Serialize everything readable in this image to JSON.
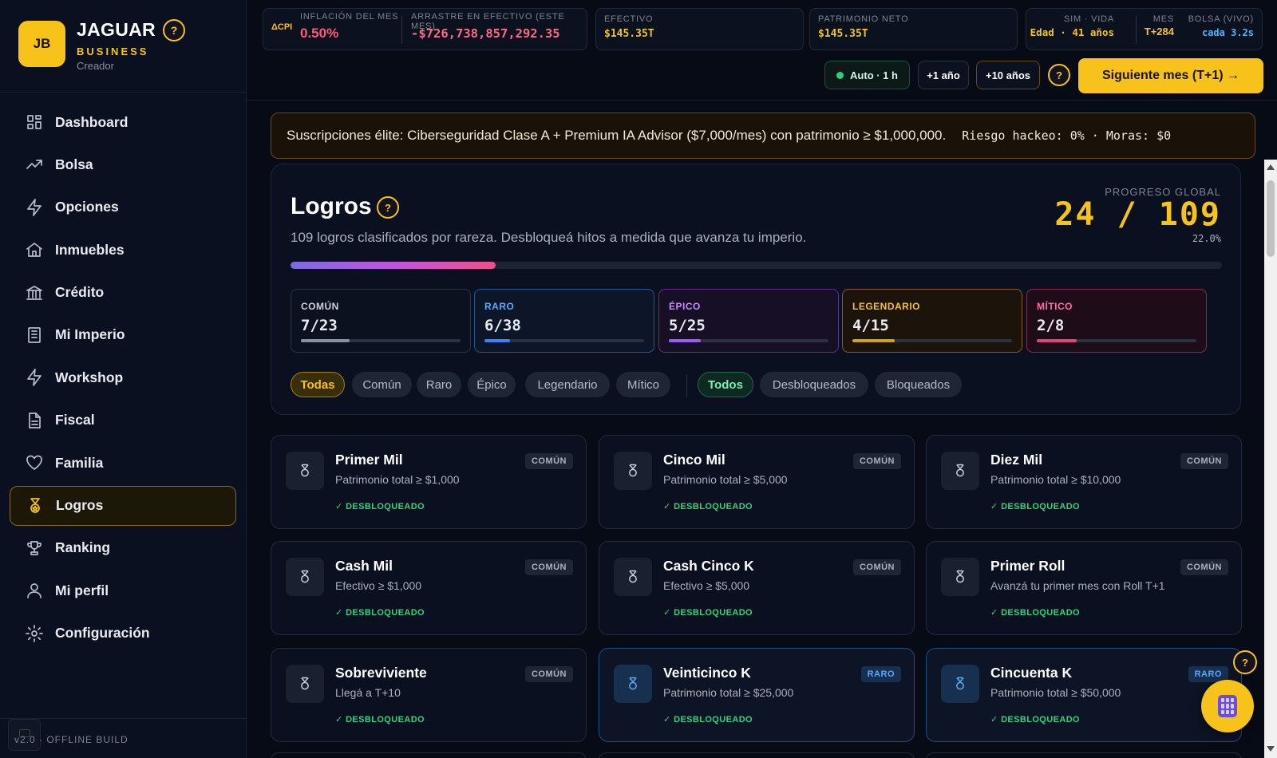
{
  "brand": {
    "logo": "JB",
    "name": "JAGUAR",
    "subtitle": "BUSINESS",
    "role": "Creador",
    "help": "?"
  },
  "nav": [
    {
      "label": "Dashboard",
      "icon": "grid-icon"
    },
    {
      "label": "Bolsa",
      "icon": "trend-icon"
    },
    {
      "label": "Opciones",
      "icon": "bolt-icon"
    },
    {
      "label": "Inmuebles",
      "icon": "home-icon"
    },
    {
      "label": "Crédito",
      "icon": "bank-icon"
    },
    {
      "label": "Mi Imperio",
      "icon": "building-icon"
    },
    {
      "label": "Workshop",
      "icon": "bolt-icon"
    },
    {
      "label": "Fiscal",
      "icon": "document-icon"
    },
    {
      "label": "Familia",
      "icon": "heart-icon"
    },
    {
      "label": "Logros",
      "icon": "medal-icon",
      "active": true
    },
    {
      "label": "Ranking",
      "icon": "trophy-icon"
    },
    {
      "label": "Mi perfil",
      "icon": "user-icon"
    },
    {
      "label": "Configuración",
      "icon": "gear-icon"
    }
  ],
  "footer": {
    "version": "v2.0 · OFFLINE BUILD"
  },
  "topbar": {
    "cpi_tag": "ΔCPI",
    "inflation_label": "INFLACIÓN DEL MES",
    "inflation_value": "0.50%",
    "drag_label": "ARRASTRE EN EFECTIVO (ESTE MES)",
    "drag_value": "-$726,738,857,292.35",
    "cash_label": "EFECTIVO",
    "cash_value": "$145.35T",
    "networth_label": "PATRIMONIO NETO",
    "networth_value": "$145.35T",
    "sim_label": "SIM · VIDA",
    "sim_value": "Edad · 41 años",
    "month_label": "MES",
    "month_value": "T+284",
    "market_label": "BOLSA (VIVO)",
    "market_value": "cada 3.2s"
  },
  "controls": {
    "auto": "Auto · 1 h",
    "plus1": "+1 año",
    "plus10": "+10 años",
    "help": "?",
    "next": "Siguiente mes (T+1) →"
  },
  "banner": {
    "text": "Suscripciones élite: Ciberseguridad Clase A + Premium IA Advisor ($7,000/mes) con patrimonio ≥ $1,000,000.",
    "risk": "Riesgo hackeo: 0% · Moras: $0"
  },
  "achievements": {
    "title": "Logros",
    "help": "?",
    "description": "109 logros clasificados por rareza. Desbloqueá hitos a medida que avanza tu imperio.",
    "progress_label": "PROGRESO GLOBAL",
    "progress_count": "24 / 109",
    "progress_pct": "22.0%",
    "progress_value": 0.22,
    "rarities": [
      {
        "label": "COMÚN",
        "value": "7/23",
        "fraction": 0.304,
        "color": "#cfd3dc",
        "bar": "#8a90a0",
        "border": "#2c3344",
        "bg": "#0c111f"
      },
      {
        "label": "RARO",
        "value": "6/38",
        "fraction": 0.158,
        "color": "#5aa8ff",
        "bar": "#3b82f6",
        "border": "#23559a",
        "bg": "#0c1628"
      },
      {
        "label": "ÉPICO",
        "value": "5/25",
        "fraction": 0.2,
        "color": "#c68cff",
        "bar": "#9b5cf0",
        "border": "#5b2f8a",
        "bg": "#170f26"
      },
      {
        "label": "LEGENDARIO",
        "value": "4/15",
        "fraction": 0.267,
        "color": "#f7c21a",
        "bar": "#d4a017",
        "border": "#8a5a1a",
        "bg": "#1c140a"
      },
      {
        "label": "MÍTICO",
        "value": "2/8",
        "fraction": 0.25,
        "color": "#ff6fa3",
        "bar": "#e0457a",
        "border": "#8a2a50",
        "bg": "#1e0d18"
      }
    ],
    "rarity_filters": [
      "Todas",
      "Común",
      "Raro",
      "Épico",
      "Legendario",
      "Mítico"
    ],
    "status_filters": [
      "Todos",
      "Desbloqueados",
      "Bloqueados"
    ]
  },
  "cards": [
    {
      "title": "Primer Mil",
      "desc": "Patrimonio total ≥ $1,000",
      "badge": "COMÚN",
      "status": "✓ DESBLOQUEADO",
      "rarity": "comun"
    },
    {
      "title": "Cinco Mil",
      "desc": "Patrimonio total ≥ $5,000",
      "badge": "COMÚN",
      "status": "✓ DESBLOQUEADO",
      "rarity": "comun"
    },
    {
      "title": "Diez Mil",
      "desc": "Patrimonio total ≥ $10,000",
      "badge": "COMÚN",
      "status": "✓ DESBLOQUEADO",
      "rarity": "comun"
    },
    {
      "title": "Cash Mil",
      "desc": "Efectivo ≥ $1,000",
      "badge": "COMÚN",
      "status": "✓ DESBLOQUEADO",
      "rarity": "comun"
    },
    {
      "title": "Cash Cinco K",
      "desc": "Efectivo ≥ $5,000",
      "badge": "COMÚN",
      "status": "✓ DESBLOQUEADO",
      "rarity": "comun"
    },
    {
      "title": "Primer Roll",
      "desc": "Avanzá tu primer mes con Roll T+1",
      "badge": "COMÚN",
      "status": "✓ DESBLOQUEADO",
      "rarity": "comun"
    },
    {
      "title": "Sobreviviente",
      "desc": "Llegá a T+10",
      "badge": "COMÚN",
      "status": "✓ DESBLOQUEADO",
      "rarity": "comun"
    },
    {
      "title": "Veinticinco K",
      "desc": "Patrimonio total ≥ $25,000",
      "badge": "RARO",
      "status": "✓ DESBLOQUEADO",
      "rarity": "raro"
    },
    {
      "title": "Cincuenta K",
      "desc": "Patrimonio total ≥ $50,000",
      "badge": "RARO",
      "status": "✓ DESBLOQUEADO",
      "rarity": "raro"
    }
  ],
  "floating": {
    "help": "?"
  }
}
